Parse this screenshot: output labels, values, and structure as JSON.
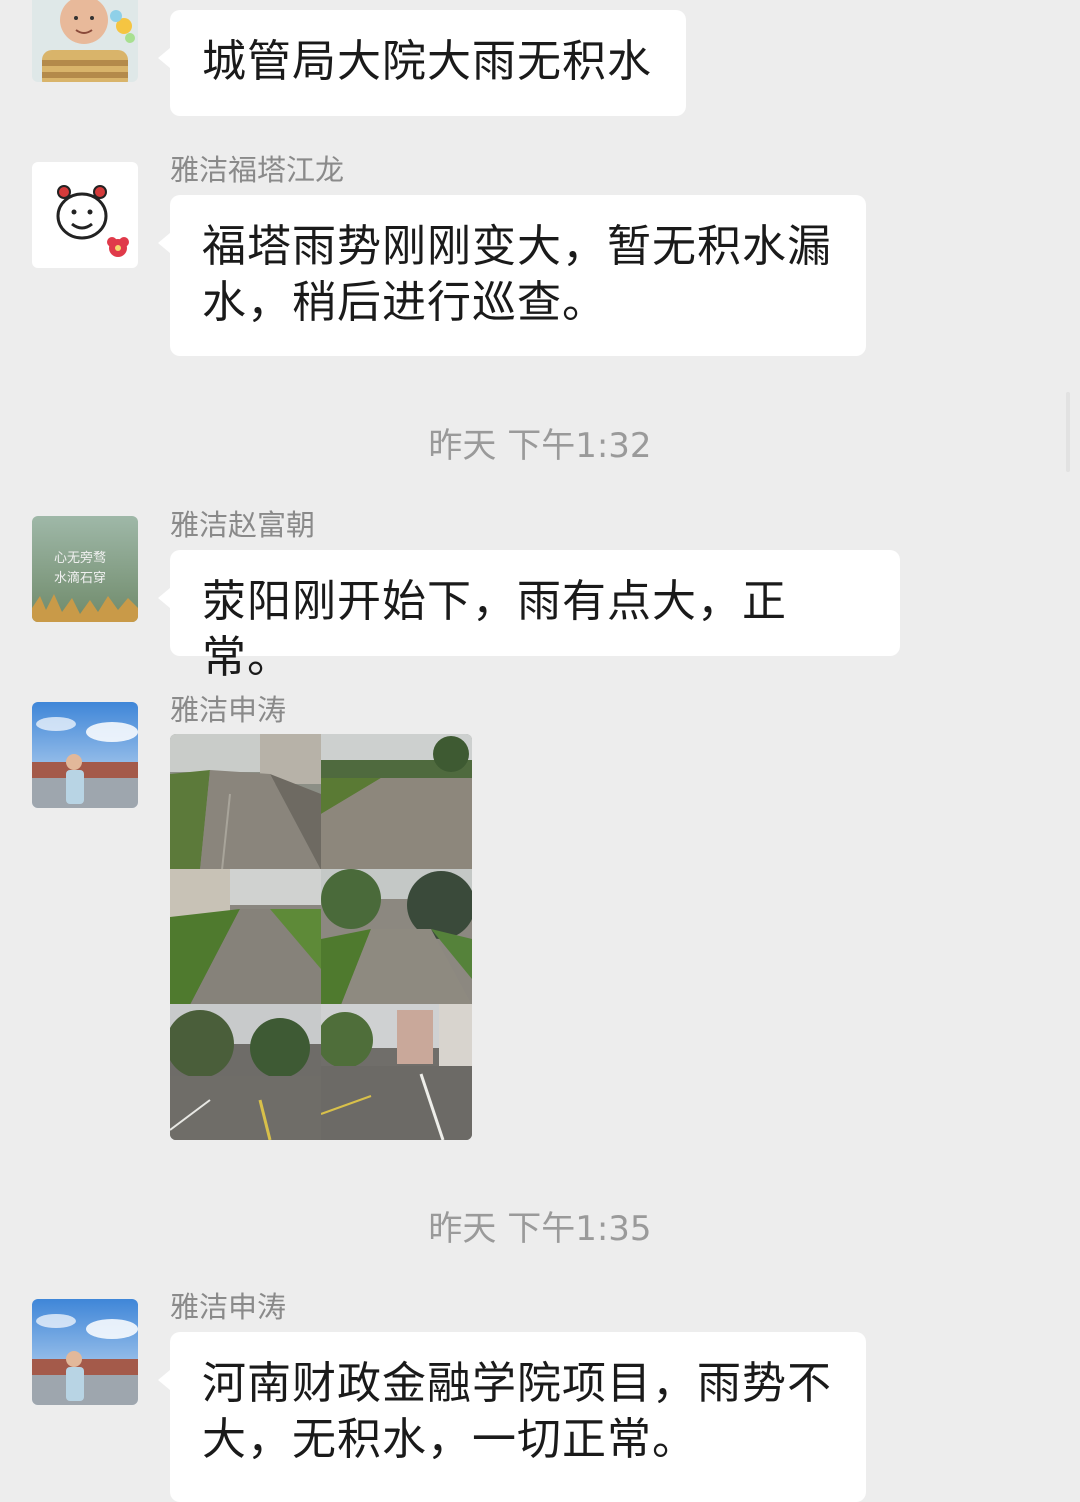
{
  "messages": [
    {
      "text": "城管局大院大雨无积水"
    },
    {
      "sender": "雅洁福塔江龙",
      "text_line1": "福塔雨势刚刚变大，暂无积水漏",
      "text_line2": "水，稍后进行巡查。"
    },
    {
      "sender": "雅洁赵富朝",
      "text": "荥阳刚开始下，雨有点大，正常。",
      "avatar_text_line1": "心无旁骛",
      "avatar_text_line2": "水滴石穿"
    },
    {
      "sender": "雅洁申涛",
      "photos": [
        {
          "icon": "rainy-road-photo"
        },
        {
          "icon": "rainy-road-photo"
        },
        {
          "icon": "rainy-road-photo"
        },
        {
          "icon": "rainy-road-photo"
        },
        {
          "icon": "rainy-street-photo"
        },
        {
          "icon": "rainy-street-photo"
        }
      ]
    },
    {
      "sender": "雅洁申涛",
      "text_line1": "河南财政金融学院项目，雨势不",
      "text_line2": "大，无积水，一切正常。"
    }
  ],
  "timestamps": [
    "昨天  下午1:32",
    "昨天  下午1:35"
  ],
  "colors": {
    "background": "#ededed",
    "bubble": "#ffffff",
    "sender": "#8a8a8a",
    "timestamp": "#9a9a9a"
  }
}
